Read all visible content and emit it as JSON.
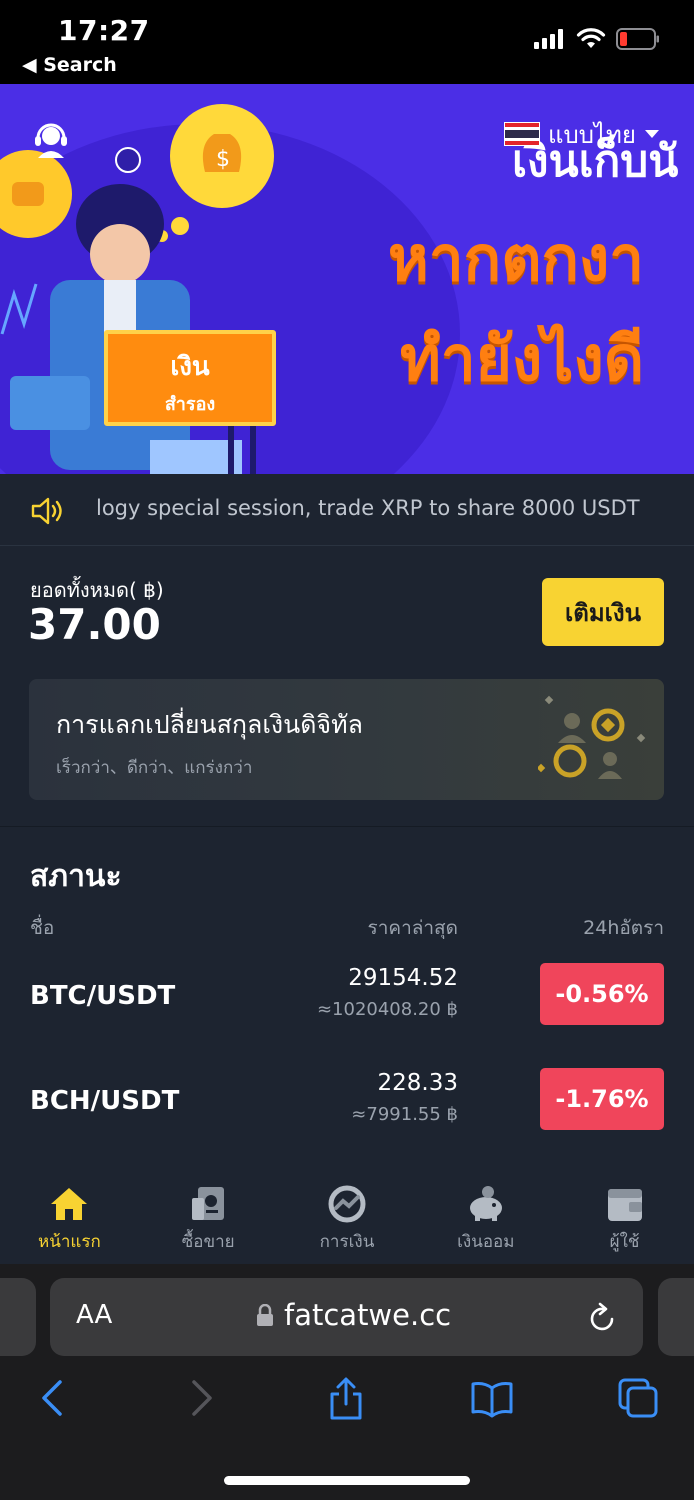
{
  "status_bar": {
    "time": "17:27",
    "back_label": "◀ Search",
    "icons": [
      "signal-icon",
      "wifi-icon",
      "battery-low-icon"
    ]
  },
  "banner": {
    "language": "แบบไทย",
    "headline_line1": "เงินเก็บนั",
    "headline_line2": "หากตกงา",
    "headline_line3": "ทำยังไงดี",
    "sign_line1": "เงิน",
    "sign_line2": "สำรอง",
    "colors": {
      "background": "#4b2ee6",
      "headline": "#ff7f11",
      "sign": "#ff8c0f"
    }
  },
  "notice": {
    "text": "logy special session, trade XRP to share 8000 USDT"
  },
  "balance": {
    "label": "ยอดทั้งหมด( ฿)",
    "value": "37.00",
    "topup_label": "เติมเงิน"
  },
  "promo": {
    "title": "การแลกเปลี่ยนสกุลเงินดิจิทัล",
    "subtitle": "เร็วกว่า、ดีกว่า、แกร่งกว่า"
  },
  "market": {
    "title": "สภานะ",
    "columns": {
      "name": "ชื่อ",
      "price": "ราคาล่าสุด",
      "change": "24hอัตรา"
    },
    "rows": [
      {
        "pair": "BTC/USDT",
        "price": "29154.52",
        "price_thb": "≈1020408.20 ฿",
        "change": "-0.56%"
      },
      {
        "pair": "BCH/USDT",
        "price": "228.33",
        "price_thb": "≈7991.55 ฿",
        "change": "-1.76%"
      }
    ],
    "colors": {
      "down": "#f0455b"
    }
  },
  "tabbar": {
    "items": [
      {
        "label": "หน้าแรก",
        "icon": "home-icon",
        "active": true
      },
      {
        "label": "ซื้อขาย",
        "icon": "trade-icon",
        "active": false
      },
      {
        "label": "การเงิน",
        "icon": "finance-icon",
        "active": false
      },
      {
        "label": "เงินออม",
        "icon": "piggy-bank-icon",
        "active": false
      },
      {
        "label": "ผู้ใช้",
        "icon": "wallet-icon",
        "active": false
      }
    ],
    "colors": {
      "active": "#f8d332",
      "inactive": "#9aa2ad"
    }
  },
  "safari": {
    "aa_label": "AA",
    "url": "fatcatwe.cc"
  }
}
